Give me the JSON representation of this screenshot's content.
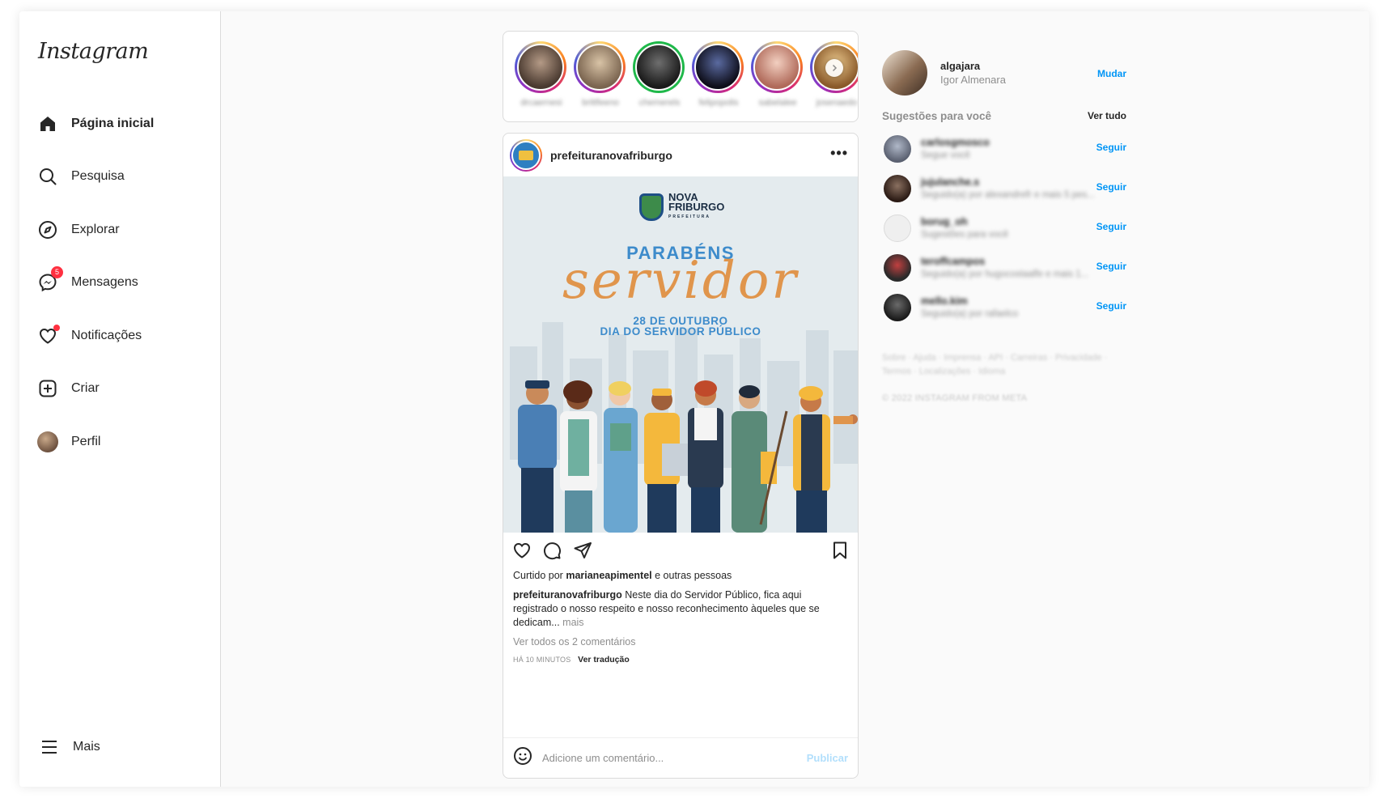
{
  "app": {
    "logo_text": "Instagram"
  },
  "sidebar": {
    "items": [
      {
        "label": "Página inicial",
        "icon": "home-icon"
      },
      {
        "label": "Pesquisa",
        "icon": "search-icon"
      },
      {
        "label": "Explorar",
        "icon": "compass-icon"
      },
      {
        "label": "Mensagens",
        "icon": "messenger-icon",
        "badge": "5"
      },
      {
        "label": "Notificações",
        "icon": "heart-icon"
      },
      {
        "label": "Criar",
        "icon": "plus-square-icon"
      },
      {
        "label": "Perfil",
        "icon": "avatar"
      }
    ],
    "more_label": "Mais"
  },
  "stories": [
    {
      "name": "drcaernesi"
    },
    {
      "name": "brittfeeno"
    },
    {
      "name": "chemerels"
    },
    {
      "name": "felipopolis"
    },
    {
      "name": "sabelalee"
    },
    {
      "name": "josenaedo"
    }
  ],
  "post": {
    "username": "prefeituranovafriburgo",
    "image": {
      "logo_line1": "NOVA",
      "logo_line2": "FRIBURGO",
      "logo_sub": "PREFEITURA",
      "headline": "PARABÉNS",
      "script_word": "servidor",
      "date_line1": "28 DE OUTUBRO",
      "date_line2": "DIA DO SERVIDOR PÚBLICO"
    },
    "liked_prefix": "Curtido por",
    "liked_user": "marianeapimentel",
    "liked_suffix": "e outras pessoas",
    "caption_user": "prefeituranovafriburgo",
    "caption_text": "Neste dia do Servidor Público, fica aqui registrado o nosso respeito e nosso reconhecimento àqueles que se dedicam...",
    "caption_more": "mais",
    "view_comments": "Ver todos os 2 comentários",
    "time": "HÁ 10 MINUTOS",
    "translate": "Ver tradução",
    "comment_placeholder": "Adicione um comentário...",
    "publish_label": "Publicar"
  },
  "profile": {
    "username": "algajara",
    "name": "Igor Almenara",
    "switch_label": "Mudar"
  },
  "suggestions": {
    "title": "Sugestões para você",
    "see_all": "Ver tudo",
    "follow_label": "Seguir",
    "items": [
      {
        "user": "carlosgmosco",
        "detail": "Segue você"
      },
      {
        "user": "jujulanche.s",
        "detail": "Seguido(a) por alexandrefr e mais 5 pes..."
      },
      {
        "user": "borug_oh",
        "detail": "Sugestões para você"
      },
      {
        "user": "teroffcampos",
        "detail": "Seguido(a) por hugocostaalfe e mais 1..."
      },
      {
        "user": "mello.kim",
        "detail": "Seguido(a) por rafaelco"
      }
    ]
  },
  "footer": {
    "links": "Sobre · Ajuda · Imprensa · API · Carreiras · Privacidade · Termos · Localizações · Idioma",
    "copyright": "© 2022 INSTAGRAM FROM META"
  },
  "colors": {
    "accent": "#0095f6",
    "badge": "#ff3040",
    "story_green": "#1fb84a"
  }
}
